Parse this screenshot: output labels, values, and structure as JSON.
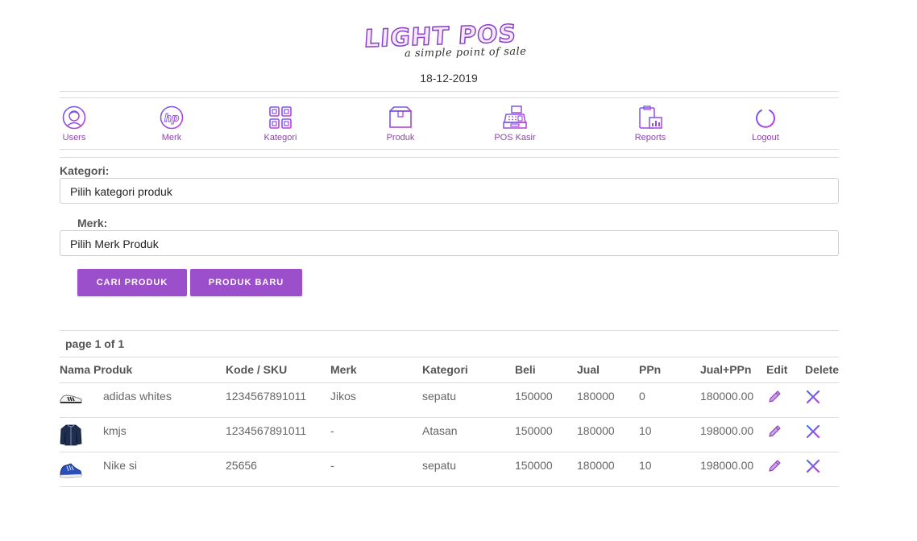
{
  "header": {
    "logo_title": "LIGHT POS",
    "logo_subtitle": "a simple point of sale",
    "date": "18-12-2019"
  },
  "nav": {
    "items": [
      {
        "label": "Users",
        "icon": "user-icon"
      },
      {
        "label": "Merk",
        "icon": "hp-logo-icon"
      },
      {
        "label": "Kategori",
        "icon": "grid-icon"
      },
      {
        "label": "Produk",
        "icon": "box-icon"
      },
      {
        "label": "POS Kasir",
        "icon": "cash-register-icon"
      },
      {
        "label": "Reports",
        "icon": "clipboard-chart-icon"
      },
      {
        "label": "Logout",
        "icon": "power-icon"
      }
    ]
  },
  "filter": {
    "kategori_label": "Kategori:",
    "kategori_value": "Pilih kategori produk",
    "merk_label": "Merk:",
    "merk_value": "Pilih Merk Produk",
    "search_button": "CARI PRODUK",
    "new_button": "PRODUK BARU"
  },
  "table": {
    "page_info": "page 1 of 1",
    "headers": [
      "Nama Produk",
      "Kode / SKU",
      "Merk",
      "Kategori",
      "Beli",
      "Jual",
      "PPn",
      "Jual+PPn",
      "Edit",
      "Delete"
    ],
    "rows": [
      {
        "image": "sneaker-white-icon",
        "name": "adidas whites",
        "sku": "1234567891011",
        "merk": "Jikos",
        "kategori": "sepatu",
        "beli": "150000",
        "jual": "180000",
        "ppn": "0",
        "jual_ppn": "180000.00"
      },
      {
        "image": "jacket-icon",
        "name": "kmjs",
        "sku": "1234567891011",
        "merk": "-",
        "kategori": "Atasan",
        "beli": "150000",
        "jual": "180000",
        "ppn": "10",
        "jual_ppn": "198000.00"
      },
      {
        "image": "sneaker-blue-icon",
        "name": "Nike si",
        "sku": "25656",
        "merk": "-",
        "kategori": "sepatu",
        "beli": "150000",
        "jual": "180000",
        "ppn": "10",
        "jual_ppn": "198000.00"
      }
    ]
  },
  "colors": {
    "accent": "#9c4fcb",
    "nav_label": "#8e44ad",
    "divider": "#dcdcdc"
  }
}
